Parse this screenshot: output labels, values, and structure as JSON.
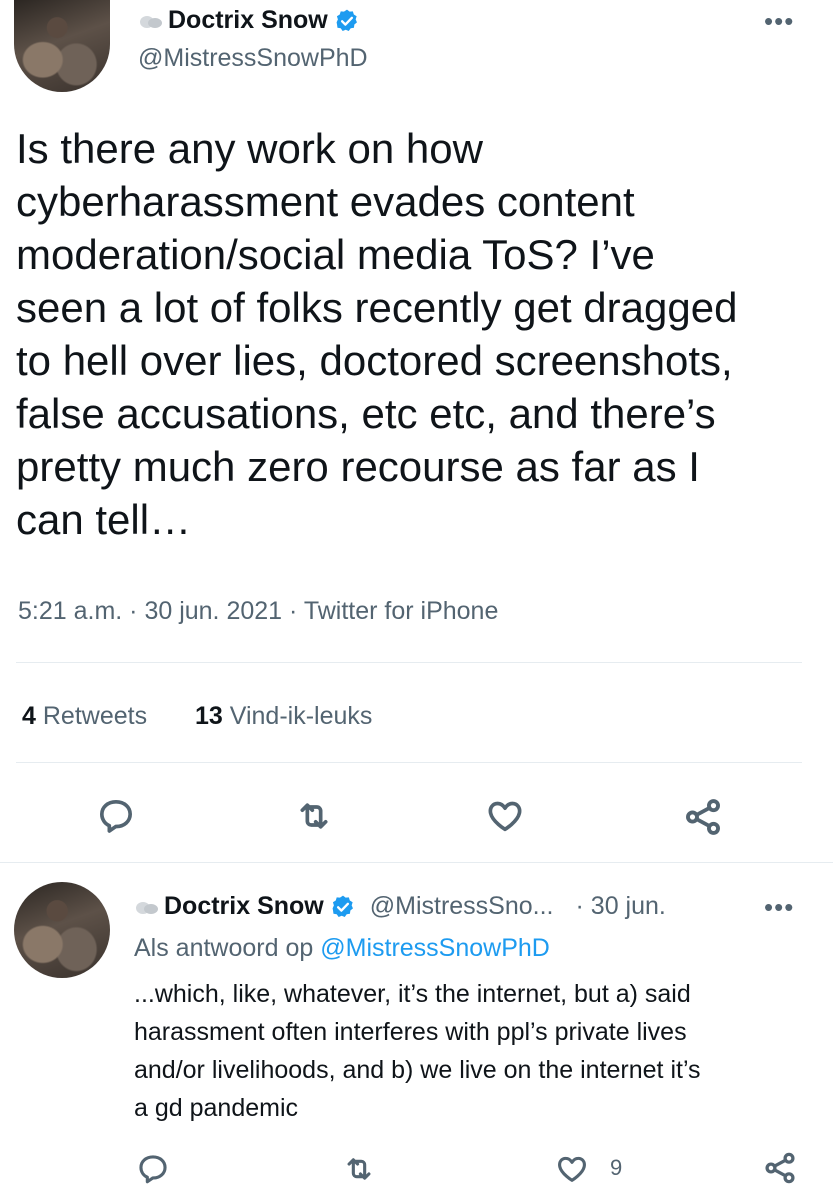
{
  "main_tweet": {
    "display_name": "Doctrix Snow",
    "handle": "@MistressSnowPhD",
    "more_label": "•••",
    "text_lines": [
      "Is there any work on how",
      "cyberharassment evades content",
      "moderation/social media ToS? I’ve",
      "seen a lot of folks recently get dragged",
      "to hell over lies, doctored screenshots,",
      "false accusations, etc etc, and there’s",
      "pretty much zero recourse as far as I",
      "can tell…"
    ],
    "meta": "5:21 a.m. · 30 jun. 2021 · Twitter for iPhone",
    "retweets_count": "4",
    "retweets_label": "Retweets",
    "likes_count": "13",
    "likes_label": "Vind-ik-leuks"
  },
  "reply_tweet": {
    "display_name": "Doctrix Snow",
    "handle": "@MistressSno...",
    "date": "· 30 jun.",
    "more_label": "•••",
    "reply_prefix": "Als antwoord op",
    "reply_to": "@MistressSnowPhD",
    "text_lines": [
      "...which, like, whatever, it’s the internet, but a) said",
      "harassment often interferes with ppl’s private lives",
      "and/or livelihoods, and b) we live on the internet it’s",
      "a gd pandemic"
    ],
    "like_count": "9"
  },
  "icons": {
    "reply": "reply-icon",
    "retweet": "retweet-icon",
    "like": "heart-icon",
    "share": "share-icon",
    "verified": "verified-badge-icon",
    "more": "more-icon"
  },
  "colors": {
    "text": "#0f1419",
    "secondary": "#536471",
    "accent": "#1d9bf0",
    "divider": "#e6ecf0"
  }
}
